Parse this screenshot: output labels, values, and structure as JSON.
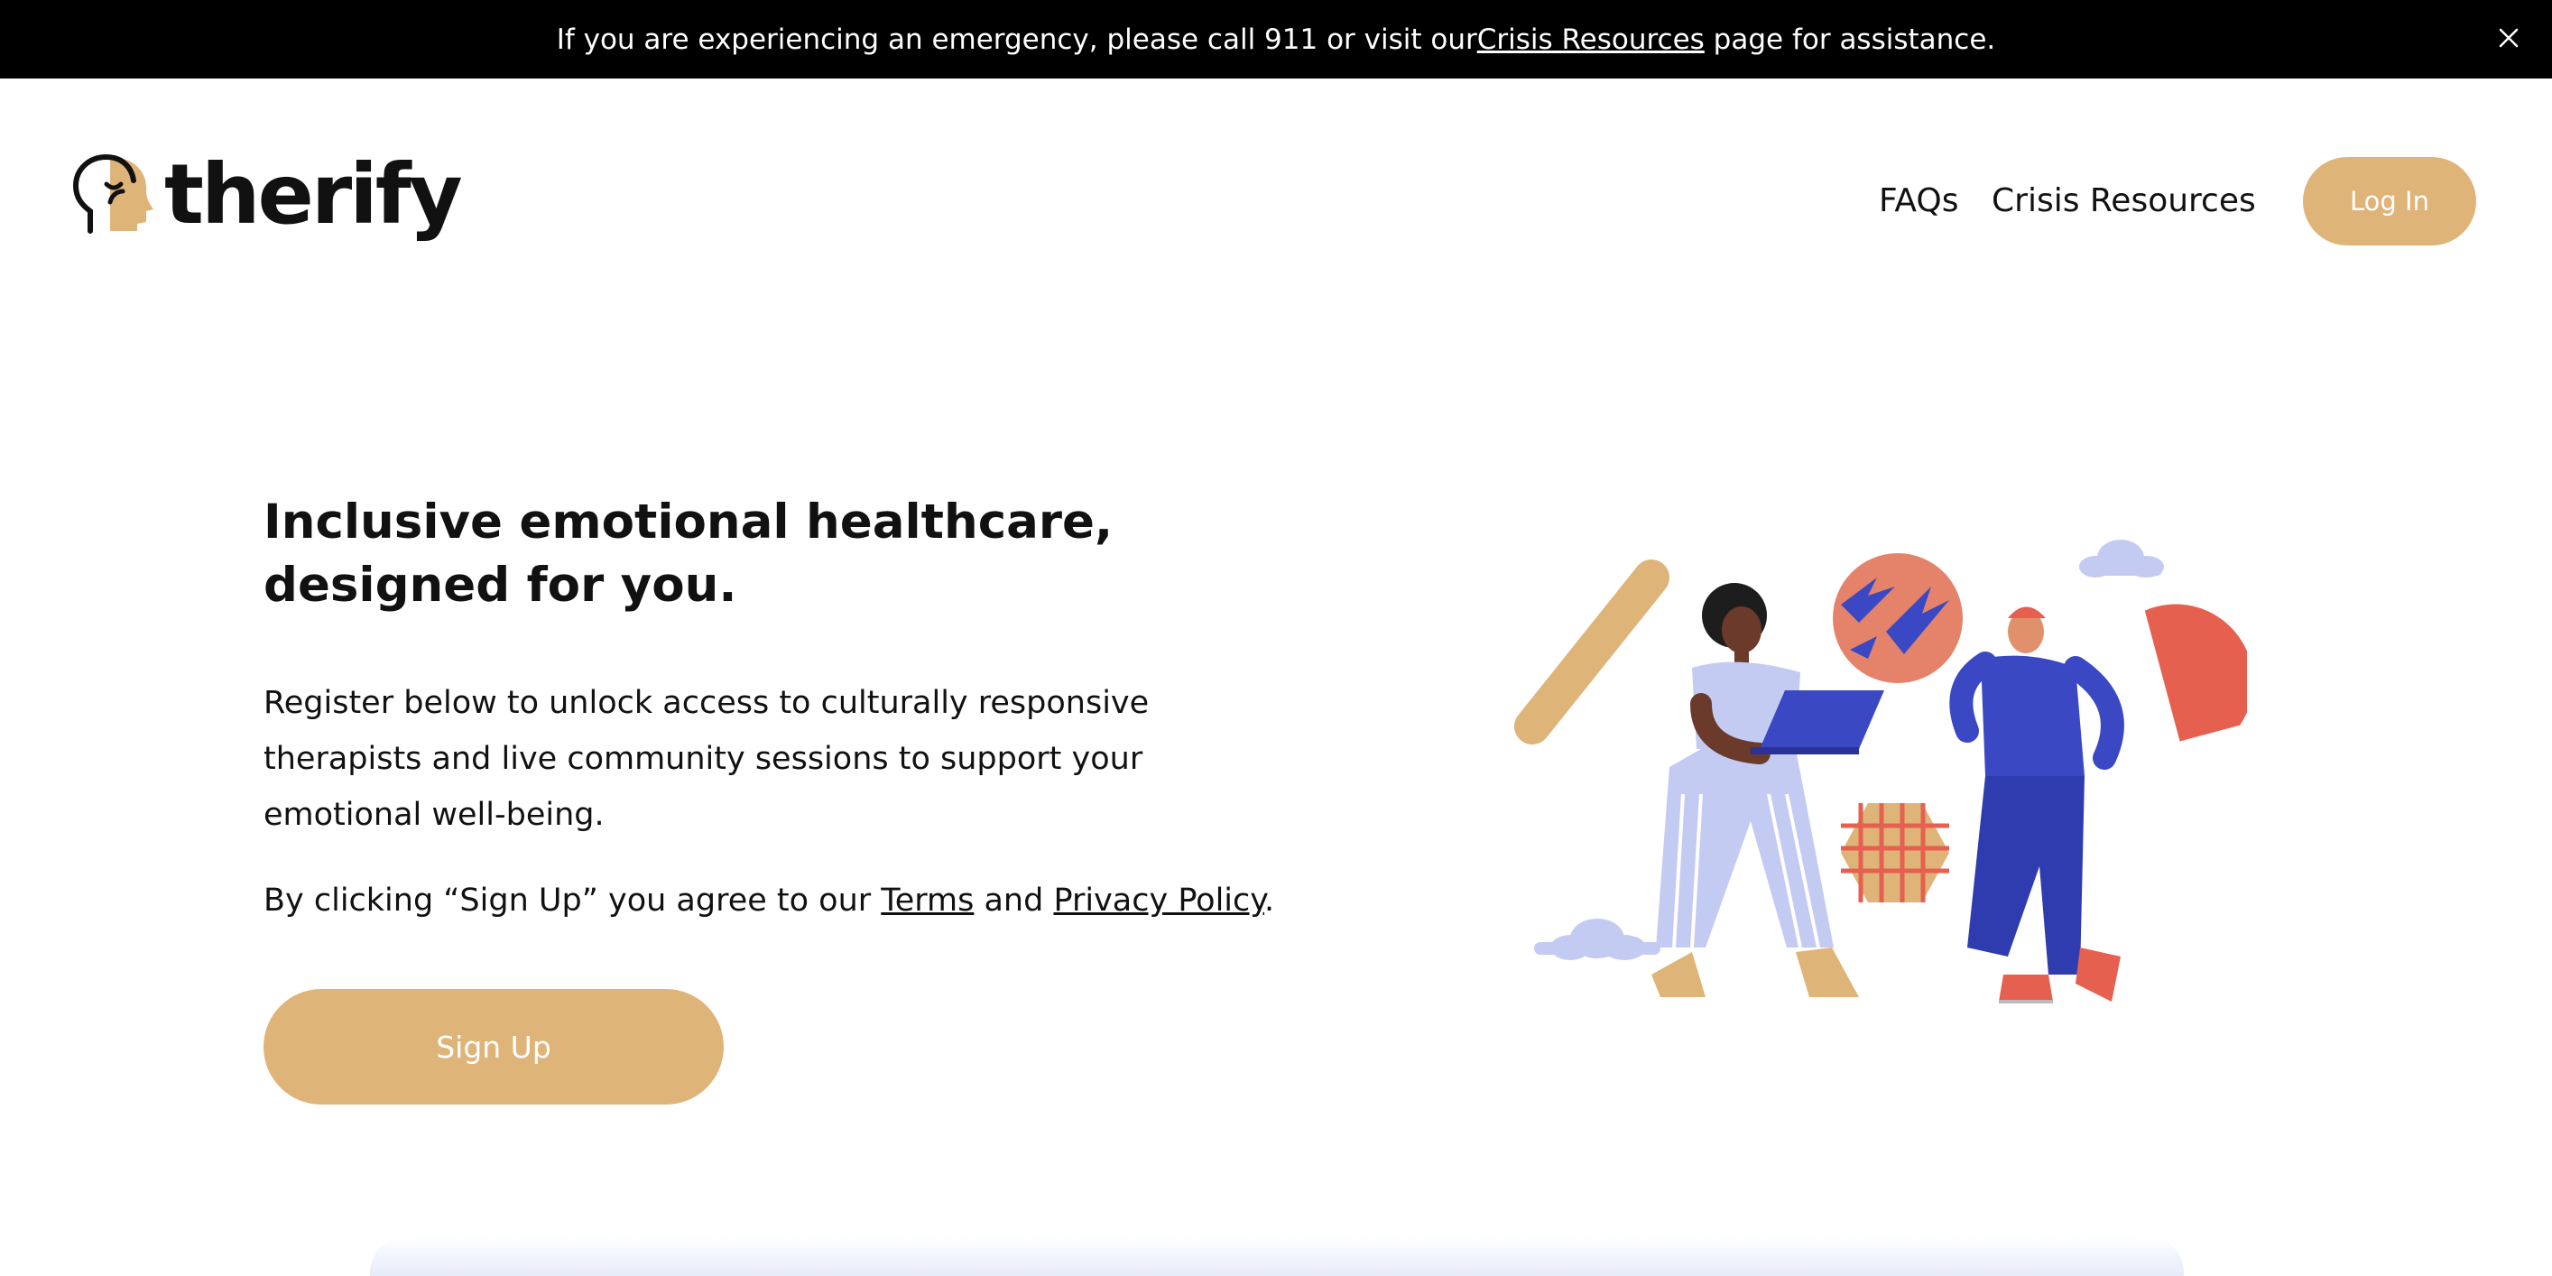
{
  "banner": {
    "text_before": "If you are experiencing an emergency, please call 911 or visit our ",
    "link_text": "Crisis Resources",
    "text_after": " page for assistance.",
    "close_icon": "close-icon"
  },
  "header": {
    "logo_text": "therify",
    "logo_icon": "head-profile-icon",
    "nav": [
      {
        "label": "FAQs"
      },
      {
        "label": "Crisis Resources"
      }
    ],
    "login_label": "Log In"
  },
  "hero": {
    "title_line1": "Inclusive emotional healthcare,",
    "title_line2": "designed for you.",
    "body_line1": "Register below to unlock access to culturally responsive",
    "body_line2": "therapists and live community sessions to support your",
    "body_line3": "emotional well-being.",
    "agree_before": "By clicking “Sign Up” you agree to our ",
    "terms_link": "Terms",
    "agree_and": " and ",
    "privacy_link": "Privacy Policy",
    "agree_after": ".",
    "signup_label": "Sign Up"
  },
  "colors": {
    "accent": "#dfb479",
    "banner_bg": "#000000",
    "illustration_blue": "#3a48c4",
    "illustration_lavender": "#c3cbf3",
    "illustration_coral": "#e5604f"
  }
}
